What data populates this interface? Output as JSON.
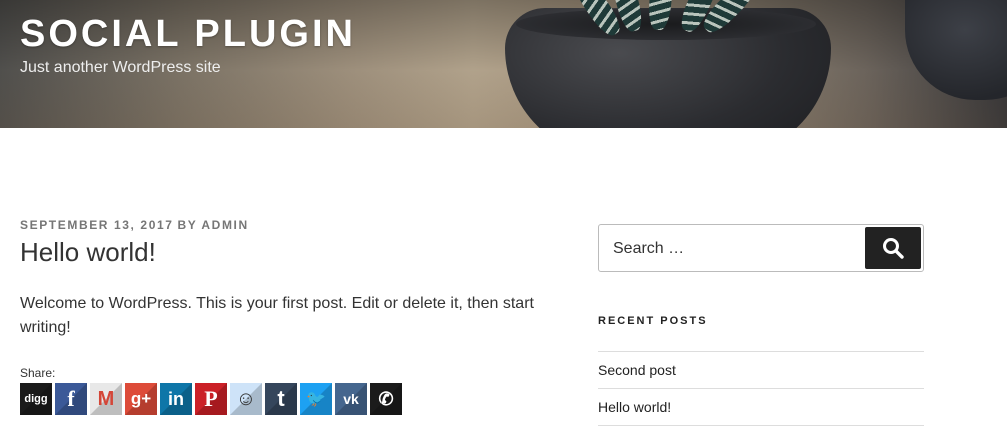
{
  "header": {
    "site_title": "SOCIAL PLUGIN",
    "site_description": "Just another WordPress site"
  },
  "post": {
    "date": "SEPTEMBER 13, 2017",
    "by": "BY",
    "author": "ADMIN",
    "title": "Hello world!",
    "body": "Welcome to WordPress. This is your first post. Edit or delete it, then start writing!",
    "share_label": "Share:",
    "share_buttons": [
      {
        "name": "digg",
        "icon": "digg-icon",
        "glyph": "digg",
        "color": "#1b1b1b"
      },
      {
        "name": "facebook",
        "icon": "facebook-icon",
        "glyph": "f",
        "color": "#3b5998"
      },
      {
        "name": "gmail",
        "icon": "gmail-icon",
        "glyph": "M",
        "color": "#e8e8e8"
      },
      {
        "name": "google-plus",
        "icon": "google-plus-icon",
        "glyph": "g+",
        "color": "#dd4b39"
      },
      {
        "name": "linkedin",
        "icon": "linkedin-icon",
        "glyph": "in",
        "color": "#0e76a8"
      },
      {
        "name": "pinterest",
        "icon": "pinterest-icon",
        "glyph": "P",
        "color": "#cb2027"
      },
      {
        "name": "reddit",
        "icon": "reddit-icon",
        "glyph": "☺",
        "color": "#cee3f8"
      },
      {
        "name": "tumblr",
        "icon": "tumblr-icon",
        "glyph": "t",
        "color": "#35465c"
      },
      {
        "name": "twitter",
        "icon": "twitter-icon",
        "glyph": "🐦",
        "color": "#1da1f2"
      },
      {
        "name": "vk",
        "icon": "vk-icon",
        "glyph": "vk",
        "color": "#45668e"
      },
      {
        "name": "whatsapp",
        "icon": "whatsapp-icon",
        "glyph": "✆",
        "color": "#1b1b1b"
      }
    ]
  },
  "sidebar": {
    "search_placeholder": "Search …",
    "recent_posts_title": "RECENT POSTS",
    "recent_posts": [
      "Second post",
      "Hello world!"
    ]
  }
}
